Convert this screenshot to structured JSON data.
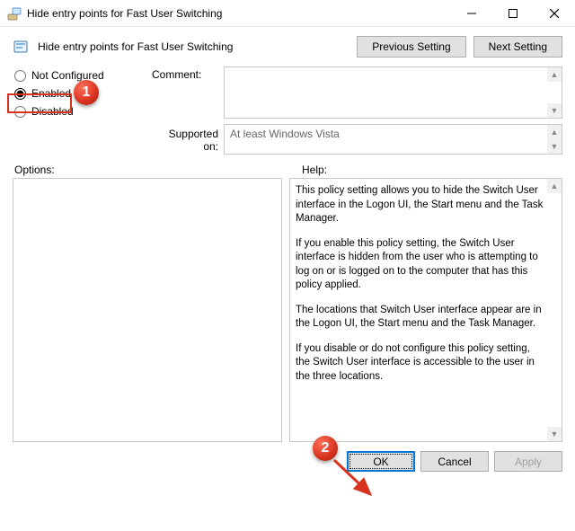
{
  "window": {
    "title": "Hide entry points for Fast User Switching",
    "minimize": "—",
    "maximize": "☐",
    "close": "✕"
  },
  "header": {
    "policy_title": "Hide entry points for Fast User Switching",
    "previous": "Previous Setting",
    "next": "Next Setting"
  },
  "state": {
    "not_configured": "Not Configured",
    "enabled": "Enabled",
    "disabled": "Disabled",
    "selected": "enabled"
  },
  "comment": {
    "label": "Comment:",
    "value": ""
  },
  "supported": {
    "label": "Supported on:",
    "value": "At least Windows Vista"
  },
  "options_label": "Options:",
  "help_label": "Help:",
  "help": {
    "p1": "This policy setting allows you to hide the Switch User interface in the Logon UI, the Start menu and the Task Manager.",
    "p2": "If you enable this policy setting, the Switch User interface is hidden from the user who is attempting to log on or is logged on to the computer that has this policy applied.",
    "p3": "The locations that Switch User interface appear are in the Logon UI, the Start menu and the Task Manager.",
    "p4": "If you disable or do not configure this policy setting, the Switch User interface is accessible to the user in the three locations."
  },
  "buttons": {
    "ok": "OK",
    "cancel": "Cancel",
    "apply": "Apply"
  },
  "annotations": {
    "c1": "1",
    "c2": "2"
  }
}
